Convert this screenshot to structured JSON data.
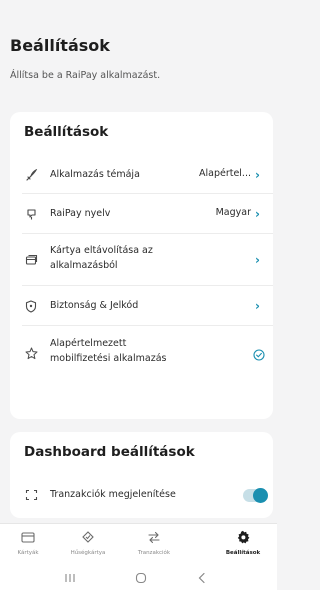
{
  "header": {
    "title": "Beállítások",
    "subtitle": "Állítsa be a RaiPay alkalmazást."
  },
  "settings_card": {
    "title": "Beállítások",
    "rows": [
      {
        "icon": "paint-brush-icon",
        "label": "Alkalmazás témája",
        "value": "Alapértel..."
      },
      {
        "icon": "language-icon",
        "label": "RaiPay nyelv",
        "value": "Magyar"
      },
      {
        "icon": "cards-icon",
        "label_line1": "Kártya eltávolítása az",
        "label_line2": "alkalmazásból",
        "value": ""
      },
      {
        "icon": "shield-icon",
        "label": "Biztonság & Jelkód",
        "value": ""
      },
      {
        "icon": "star-icon",
        "label_line1": "Alapértelmezett",
        "label_line2": "mobilfizetési alkalmazás",
        "value": ""
      }
    ]
  },
  "dashboard_card": {
    "title": "Dashboard beállítások",
    "rows": [
      {
        "icon": "transactions-frame-icon",
        "label": "Tranzakciók megjelenítése",
        "toggle_on": true
      }
    ]
  },
  "tabbar": {
    "tabs": [
      {
        "icon": "card-icon",
        "label": "Kártyák",
        "active": false
      },
      {
        "icon": "loyalty-card-icon",
        "label": "Hűségkártya",
        "active": false
      },
      {
        "icon": "transfer-arrows-icon",
        "label": "Tranzakciók",
        "active": false
      },
      {
        "icon": "gear-icon",
        "label": "Beállítások",
        "active": true
      }
    ]
  },
  "colors": {
    "accent": "#1a8fb0",
    "background": "#f4f4f5",
    "card": "#ffffff"
  }
}
